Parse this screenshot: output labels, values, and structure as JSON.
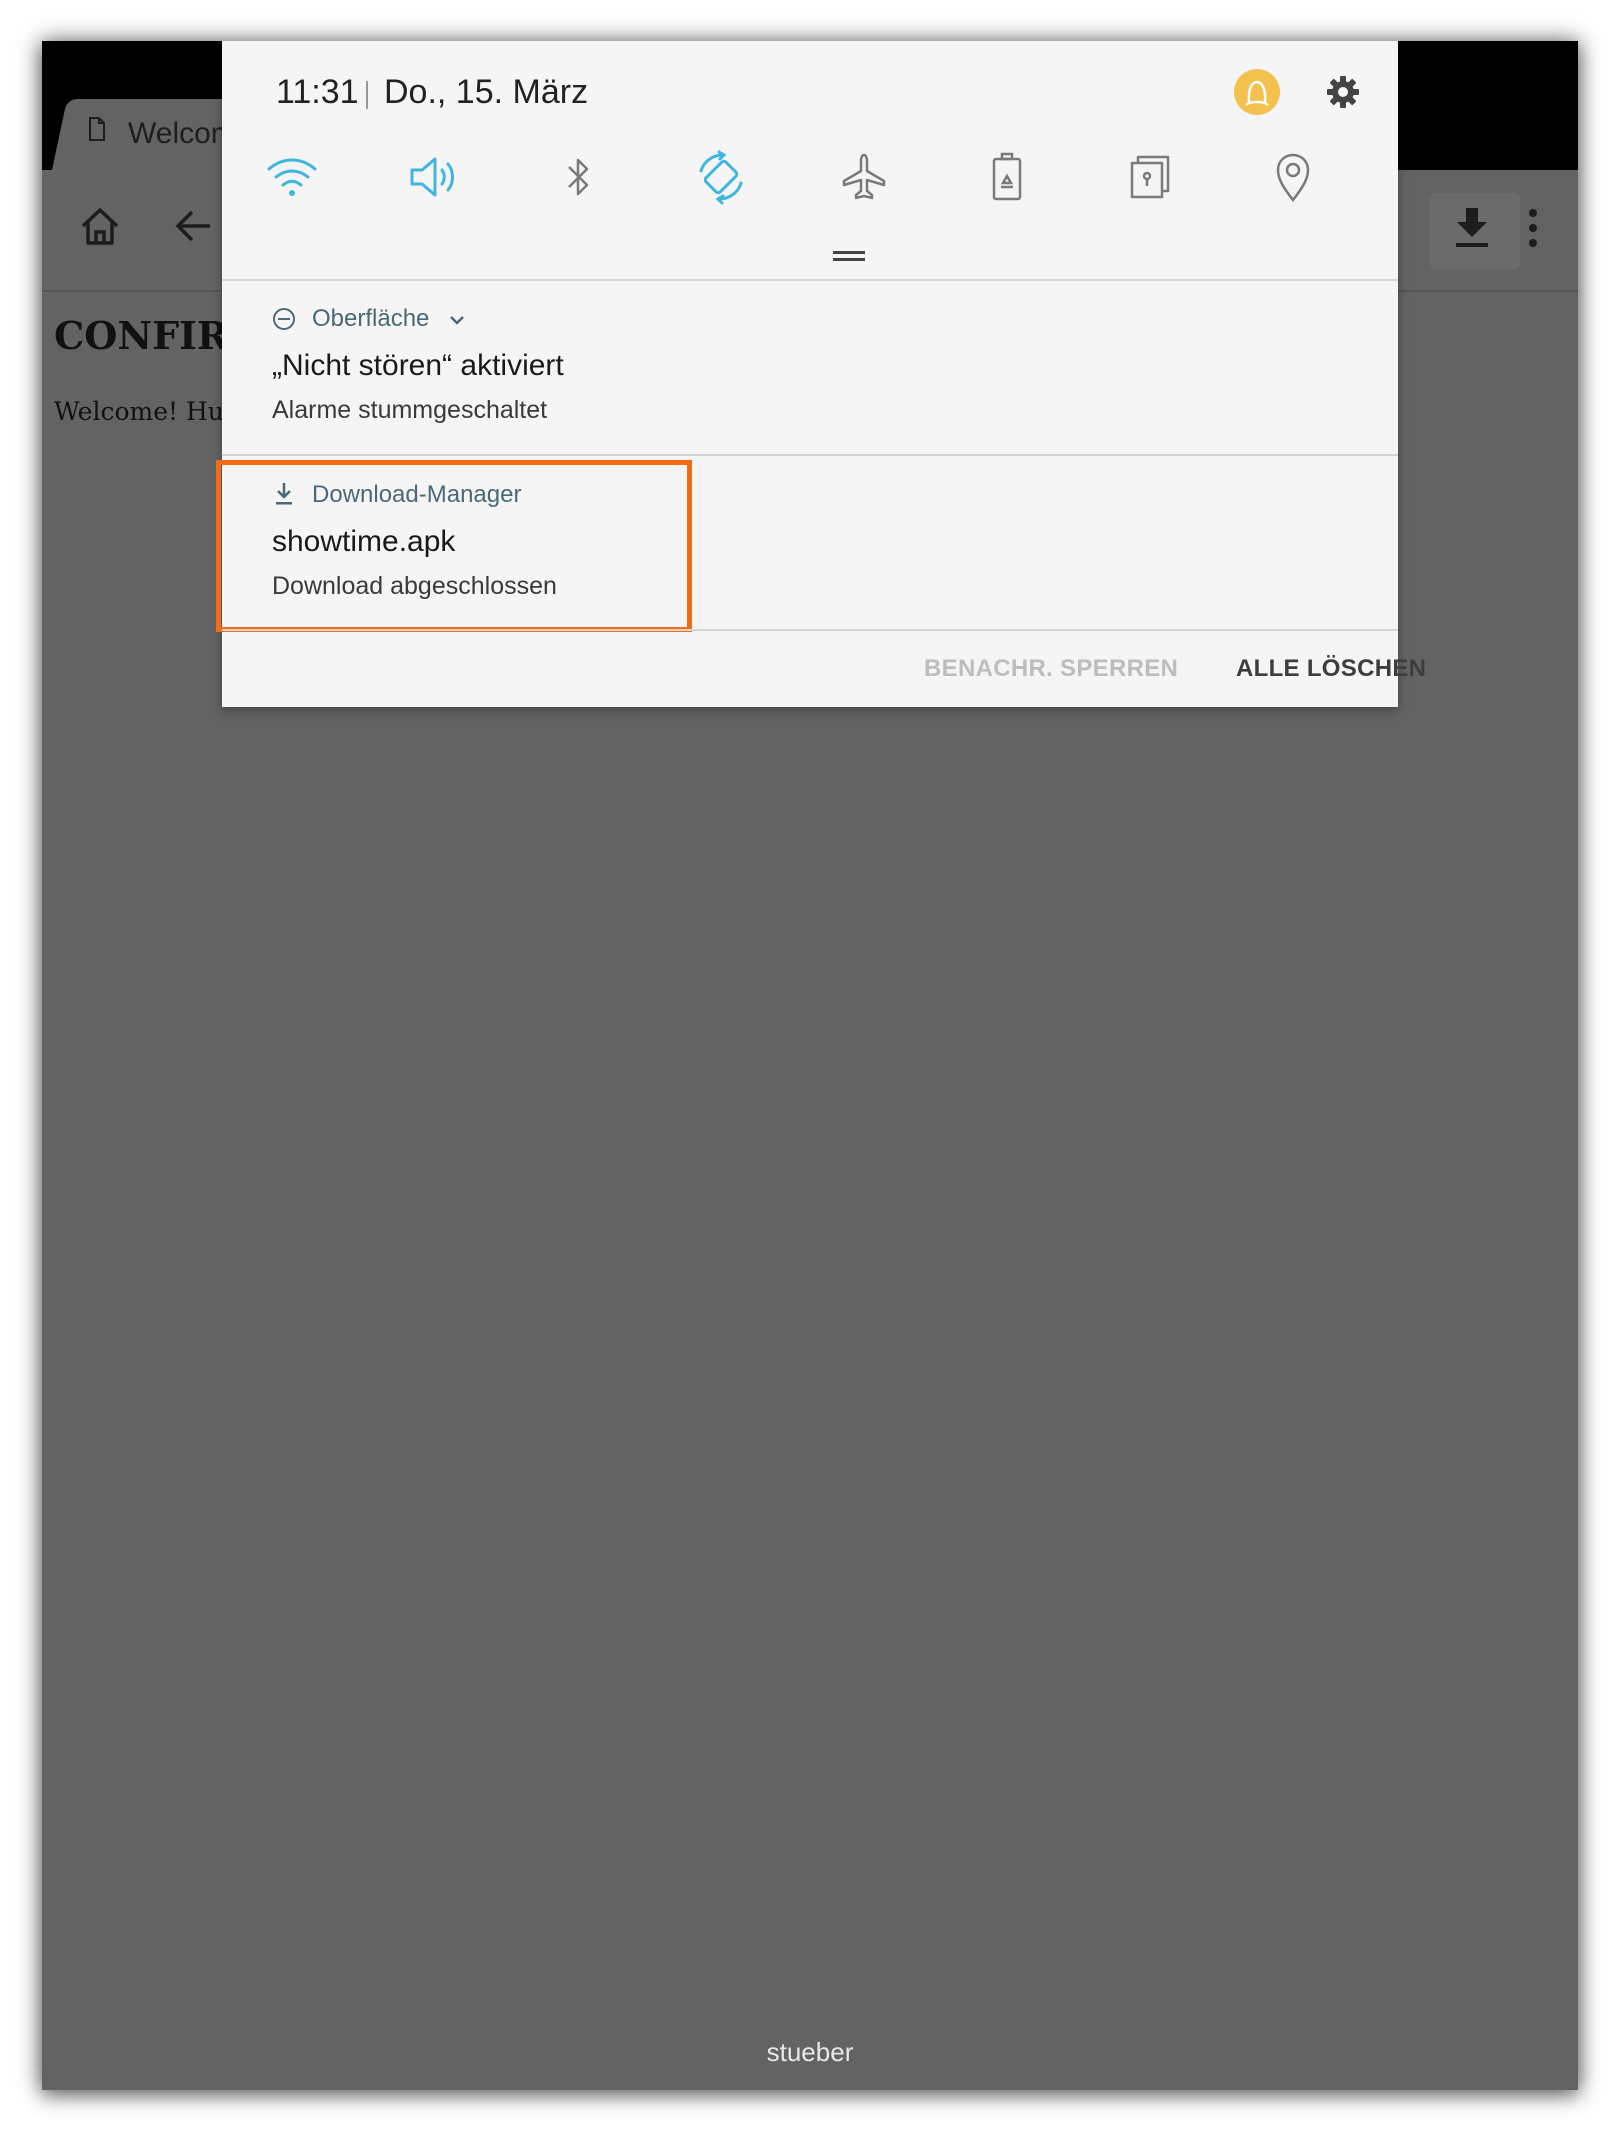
{
  "browser": {
    "tab_title": "Welcom",
    "page_heading": "CONFIRE",
    "page_text": "Welcome! Hul",
    "footer_user": "stueber"
  },
  "status": {
    "time": "11:31",
    "date": "Do., 15. März"
  },
  "quick_settings": [
    {
      "icon": "wifi-icon",
      "active": true
    },
    {
      "icon": "sound-icon",
      "active": true
    },
    {
      "icon": "bluetooth-icon",
      "active": false
    },
    {
      "icon": "auto-rotate-icon",
      "active": true
    },
    {
      "icon": "airplane-mode-icon",
      "active": false
    },
    {
      "icon": "power-saving-icon",
      "active": false
    },
    {
      "icon": "secure-folder-icon",
      "active": false
    },
    {
      "icon": "location-icon",
      "active": false
    }
  ],
  "notifications": [
    {
      "app": "Oberfläche",
      "title": "„Nicht stören“ aktiviert",
      "subtitle": "Alarme stummgeschaltet"
    },
    {
      "app": "Download-Manager",
      "title": "showtime.apk",
      "subtitle": "Download abgeschlossen"
    }
  ],
  "actions": {
    "block": "BENACHR. SPERREN",
    "clear_all": "ALLE LÖSCHEN"
  },
  "colors": {
    "active_icon": "#3fb6e0",
    "inactive_icon": "#7a7a7a",
    "highlight": "#f26b16",
    "avatar": "#f2c14e"
  }
}
